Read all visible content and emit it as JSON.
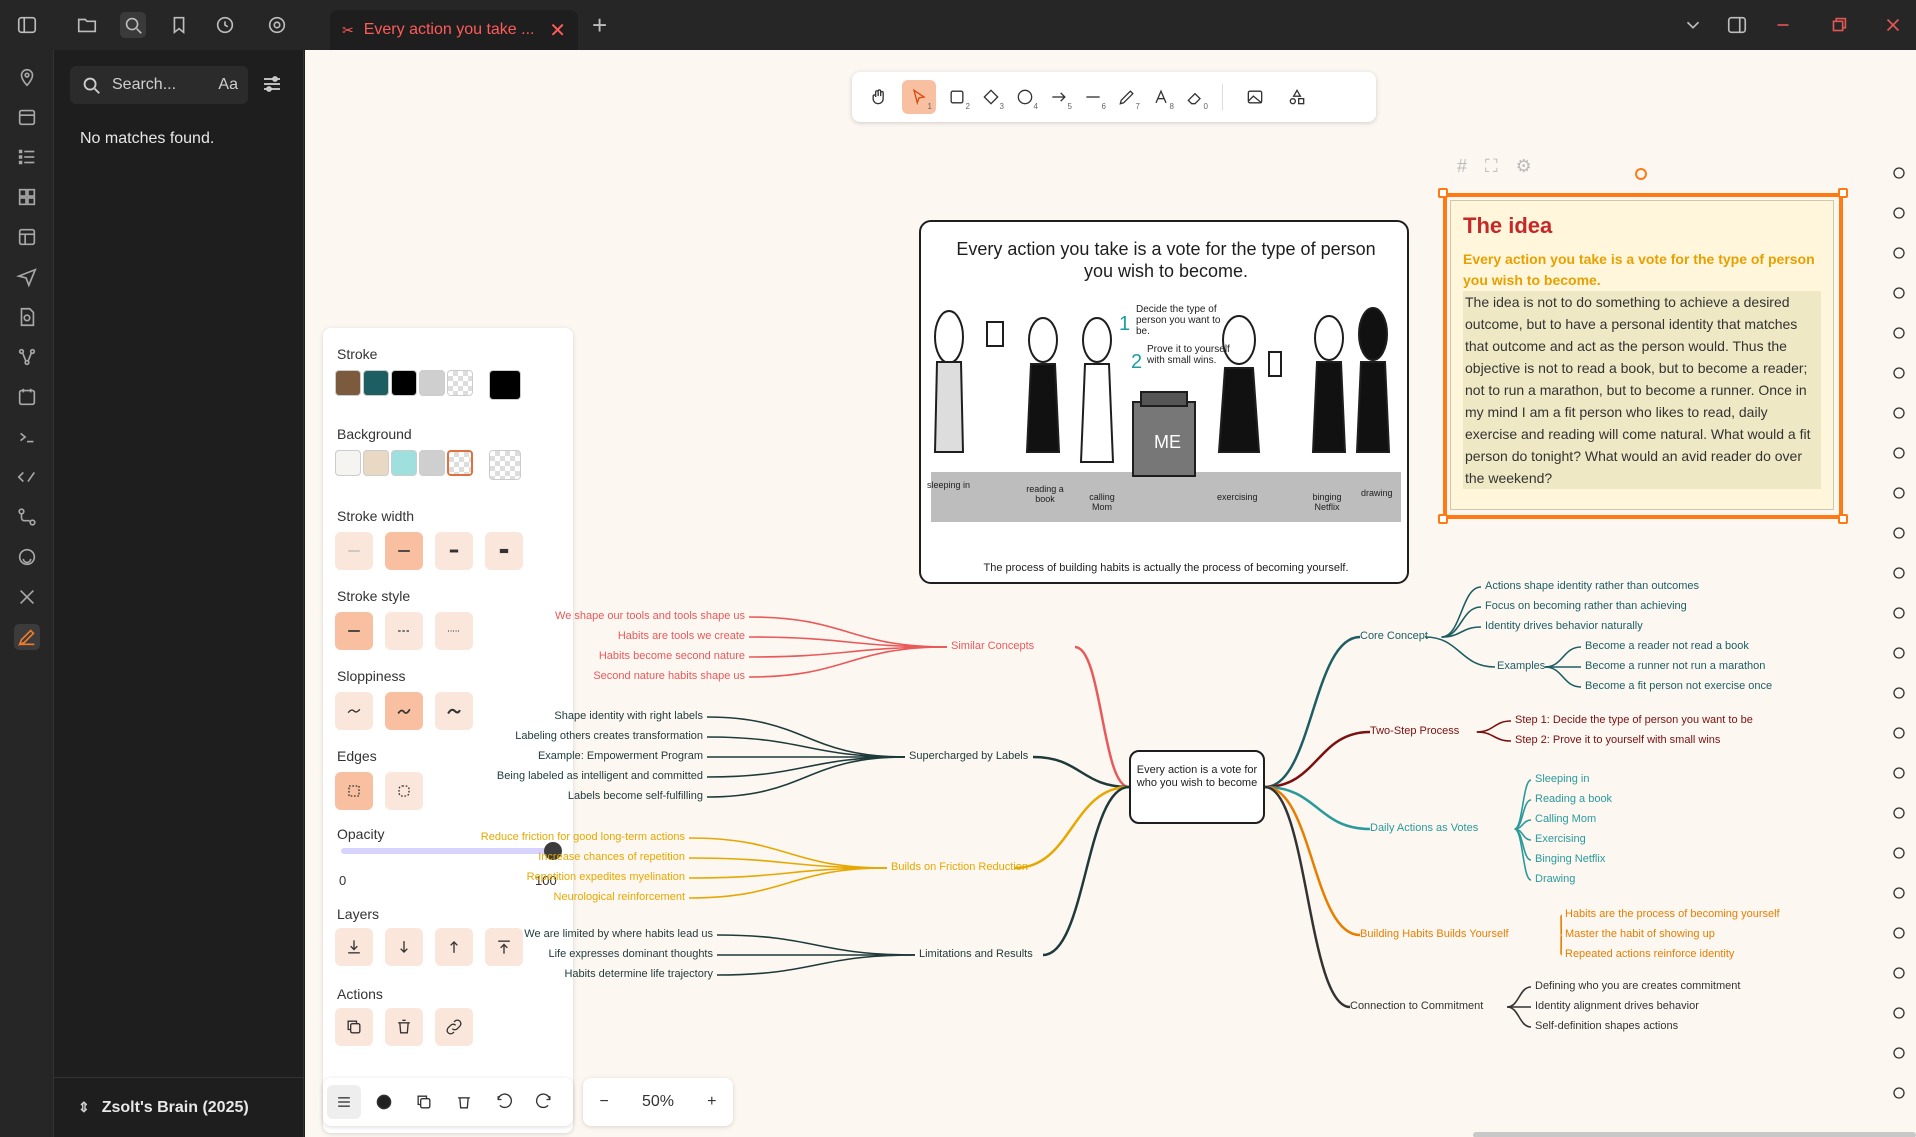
{
  "tab": {
    "title": "Every action you take ...",
    "close": "✕",
    "new": "+"
  },
  "search": {
    "placeholder": "Search...",
    "case_label": "Aa",
    "result": "No matches found."
  },
  "vault": {
    "name": "Zsolt's Brain (2025)"
  },
  "props": {
    "stroke": "Stroke",
    "background": "Background",
    "stroke_width": "Stroke width",
    "stroke_style": "Stroke style",
    "sloppiness": "Sloppiness",
    "edges": "Edges",
    "opacity": "Opacity",
    "opacity_min": "0",
    "opacity_max": "100",
    "opacity_value": 100,
    "layers": "Layers",
    "actions": "Actions",
    "stroke_colors": [
      "#7b5a3e",
      "#1d5e63",
      "#000000",
      "#cfcfcf"
    ],
    "stroke_current": "#000000",
    "bg_colors": [
      "#f6f4f0",
      "#e8d8c4",
      "#9fe0df",
      "#cfcfcf"
    ]
  },
  "zoom": {
    "minus": "−",
    "value": "50%",
    "plus": "+"
  },
  "frame": {
    "title": "Every action you take is a vote for the type of person you wish to become.",
    "caption": "The process of building habits is actually the process of becoming yourself.",
    "steps": [
      {
        "n": "1",
        "text": "Decide the type of person you want to be."
      },
      {
        "n": "2",
        "text": "Prove it to yourself with small wins."
      }
    ],
    "box": "ME",
    "labels": [
      "sleeping in",
      "reading a book",
      "calling Mom",
      "exercising",
      "binging Netflix",
      "drawing"
    ]
  },
  "idea": {
    "title": "The idea",
    "subtitle": "Every action you take is a vote for the type of person you wish to become.",
    "body": "The idea is not to do something to achieve a desired outcome, but to have a personal identity that matches that outcome and act as the person would. Thus the objective is not to read a book, but to become a reader; not to run a marathon, but to become a runner. Once in my mind I am a fit person who likes to read, daily exercise and reading will come natural. What would a fit person do tonight? What would an avid reader do over the weekend?"
  },
  "mindmap": {
    "center": "Every action is a vote for who you wish to become",
    "colors": {
      "similar": "#e85a5a",
      "labels": "#1e3a3a",
      "friction": "#e6a800",
      "limits": "#1e3a3a",
      "core": "#1d5e63",
      "twostep": "#7a1010",
      "votes": "#2a9a9a",
      "building": "#e67e00",
      "commit": "#333333"
    },
    "similar": {
      "label": "Similar Concepts",
      "items": [
        "We shape our tools and tools shape us",
        "Habits are tools we create",
        "Habits become second nature",
        "Second nature habits shape us"
      ]
    },
    "labels": {
      "label": "Supercharged by Labels",
      "items": [
        "Shape identity with right labels",
        "Labeling others creates transformation",
        "Example: Empowerment Program",
        "Being labeled as intelligent and committed",
        "Labels become self-fulfilling"
      ]
    },
    "friction": {
      "label": "Builds on Friction Reduction",
      "items": [
        "Reduce friction for good long-term actions",
        "Increase chances of repetition",
        "Repetition expedites myelination",
        "Neurological reinforcement"
      ]
    },
    "limits": {
      "label": "Limitations and Results",
      "items": [
        "We are limited by where habits lead us",
        "Life expresses dominant thoughts",
        "Habits determine life trajectory"
      ]
    },
    "core": {
      "label": "Core Concept",
      "items": [
        "Actions shape identity rather than outcomes",
        "Focus on becoming rather than achieving",
        "Identity drives behavior naturally"
      ],
      "examples_label": "Examples",
      "examples": [
        "Become a reader not read a book",
        "Become a runner not run a marathon",
        "Become a fit person not exercise once"
      ]
    },
    "twostep": {
      "label": "Two-Step Process",
      "items": [
        "Step 1: Decide the type of person you want to be",
        "Step 2: Prove it to yourself with small wins"
      ]
    },
    "votes": {
      "label": "Daily Actions as Votes",
      "items": [
        "Sleeping in",
        "Reading a book",
        "Calling Mom",
        "Exercising",
        "Binging Netflix",
        "Drawing"
      ]
    },
    "building": {
      "label": "Building Habits Builds Yourself",
      "items": [
        "Habits are the process of becoming yourself",
        "Master the habit of showing up",
        "Repeated actions reinforce identity"
      ]
    },
    "commit": {
      "label": "Connection to Commitment",
      "items": [
        "Defining who you are creates commitment",
        "Identity alignment drives behavior",
        "Self-definition shapes actions"
      ]
    }
  }
}
